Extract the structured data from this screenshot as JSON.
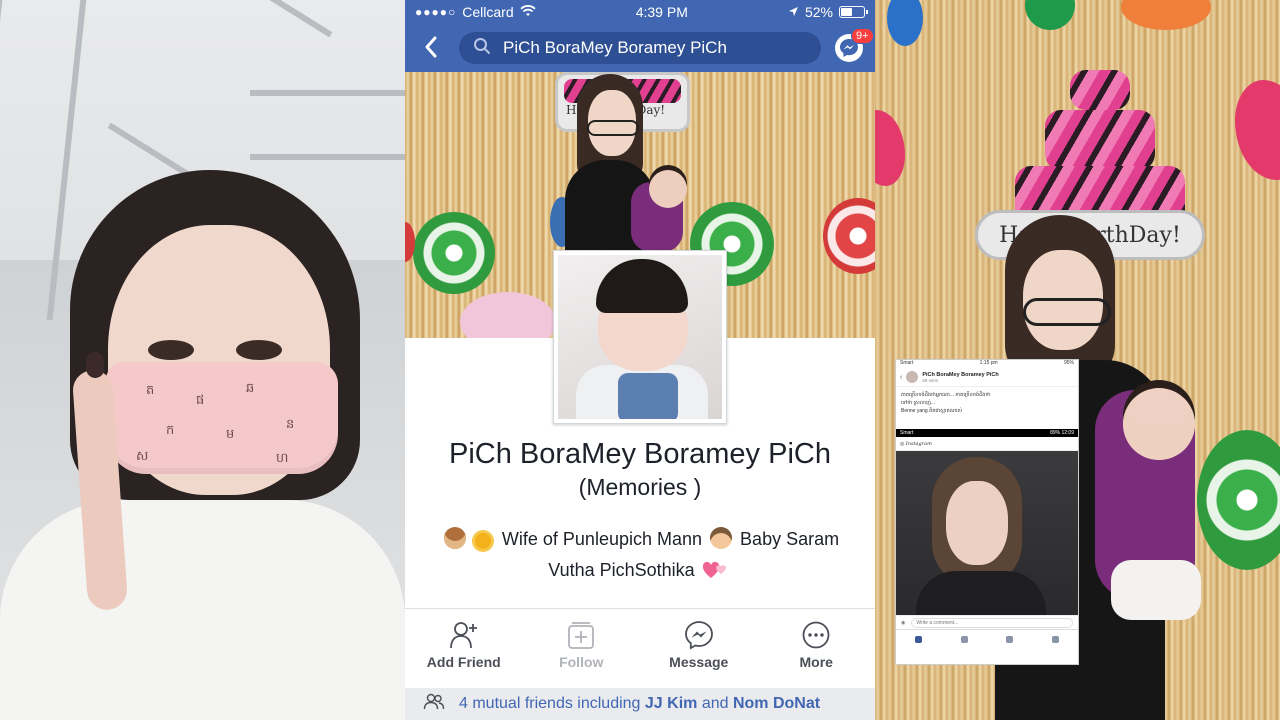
{
  "status_bar": {
    "signal": "●●●●○",
    "carrier": "Cellcard",
    "time": "4:39 PM",
    "battery": "52%",
    "battery_level": 0.52
  },
  "search": {
    "query": "PiCh BoraMey Boramey PiCh"
  },
  "messenger_badge": "9+",
  "cover_banner_text": "HappyBirthDay!",
  "profile": {
    "name": "PiCh BoraMey Boramey PiCh",
    "alt_name": "(Memories )",
    "bio_line1": "Wife of Punleupich Mann",
    "bio_line2_prefix": "Baby Saram",
    "bio_line2": "Vutha PichSothika"
  },
  "actions": [
    {
      "label": "Add Friend",
      "icon": "add-friend-icon",
      "enabled": true
    },
    {
      "label": "Follow",
      "icon": "follow-icon",
      "enabled": false
    },
    {
      "label": "Message",
      "icon": "messenger-icon",
      "enabled": true
    },
    {
      "label": "More",
      "icon": "more-icon",
      "enabled": true
    }
  ],
  "mutual": {
    "prefix": "4 mutual friends including",
    "friend1": "JJ Kim",
    "and": "and",
    "friend2": "Nom DoNat"
  },
  "inset": {
    "status_left": "Smart",
    "status_time": "1:15 pm",
    "status_right": "95%",
    "poster": "PiCh BoraMey Boramey PiCh",
    "time": "59 mins",
    "post_line1": "ភាគច្រើនចង់ដឹងថាអ្នកណា... ភាគច្រើនចង់ដឹងថា",
    "post_line2": "ទៅថា ស្រលាញ់...",
    "post_line3": "Benne yang ពិតជាស្អាតណាស់",
    "status2_left": "Smart",
    "status2_right": "89%  12:09",
    "app": "Instagram",
    "comment_placeholder": "Write a comment..."
  },
  "colors": {
    "facebook_blue": "#4267b2",
    "search_bg": "#2e4f94",
    "badge_red": "#fa3e3e",
    "page_bg": "#e9ebee"
  }
}
